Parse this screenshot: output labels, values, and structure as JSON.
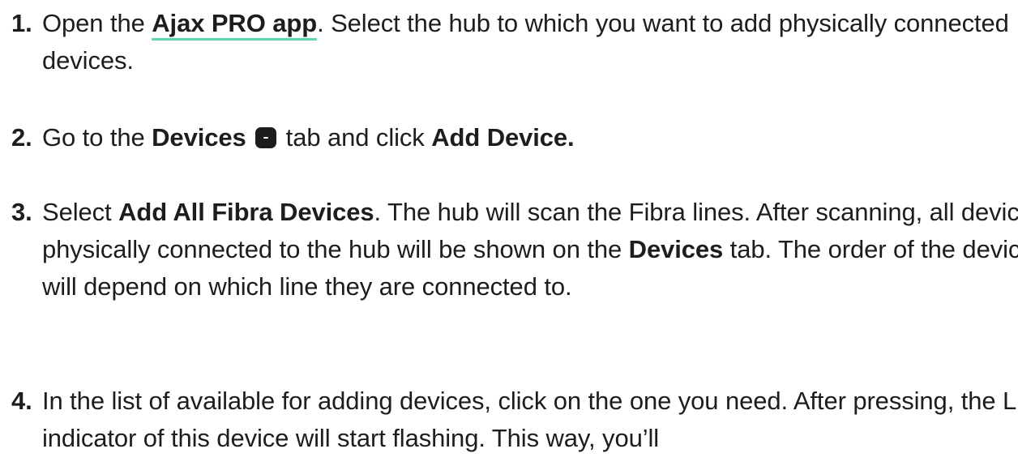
{
  "steps": [
    {
      "num": "1.",
      "text_a": "Open the ",
      "link": "Ajax PRO app",
      "text_b": ". Select the hub to which you want to add physically connected devices."
    },
    {
      "num": "2.",
      "text_a": "Go to the ",
      "bold_a": "Devices",
      "icon": "devices-tab-icon",
      "text_b": " tab and click ",
      "bold_b": "Add Device."
    },
    {
      "num": "3.",
      "text_a": "Select ",
      "bold_a": "Add All Fibra Devices",
      "text_b": ". The hub will scan the Fibra lines. After scanning, all devices physically connected to the hub will be shown on the ",
      "bold_b": "Devices",
      "text_c": " tab. The order of the devices will depend on which line they are connected to."
    },
    {
      "num": "4.",
      "text_a": "In the list of available for adding devices, click on the one you need. After pressing, the LED indicator of this device will start flashing. This way, you’ll"
    }
  ],
  "colors": {
    "link_underline": "#5fd6a8",
    "text": "#1d1d1f"
  }
}
